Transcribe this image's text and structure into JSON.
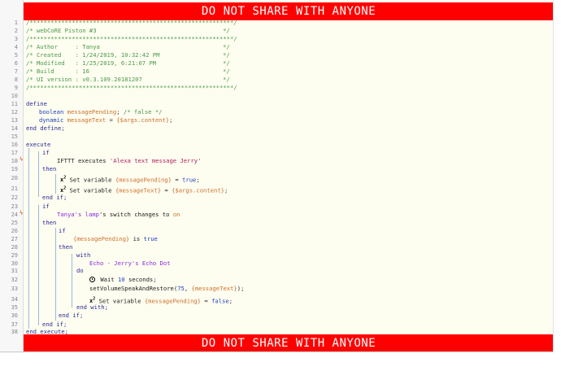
{
  "banner": {
    "top": "DO NOT SHARE WITH ANYONE",
    "bottom": "DO NOT SHARE WITH ANYONE"
  },
  "markers": {
    "trigger": "ϟ"
  },
  "line_numbers": [
    "1",
    "2",
    "3",
    "4",
    "5",
    "6",
    "7",
    "8",
    "9",
    "10",
    "11",
    "12",
    "13",
    "14",
    "15",
    "16",
    "17",
    "18",
    "19",
    "20",
    "21",
    "22",
    "23",
    "24",
    "25",
    "26",
    "27",
    "28",
    "29",
    "30",
    "31",
    "32",
    "33",
    "34",
    "35",
    "36",
    "37",
    "38"
  ],
  "code": {
    "l1": "/**********************************************************/",
    "l2a": "/* webCoRE Piston #3",
    "l2b": "*/",
    "l3": "/**********************************************************/",
    "l4a": "/* Author     : Tanya",
    "l4b": "*/",
    "l5a": "/* Created    : 1/24/2019, 10:32:42 PM",
    "l5b": "*/",
    "l6a": "/* Modified   : 1/25/2019, 6:21:07 PM",
    "l6b": "*/",
    "l7a": "/* Build      : 16",
    "l7b": "*/",
    "l8a": "/* UI version : v0.3.109.20181207",
    "l8b": "*/",
    "l9": "/**********************************************************/",
    "l11": "define",
    "l12_type": "boolean",
    "l12_var": "messagePending",
    "l12_rest": "; ",
    "l12_cmt": "/* false */",
    "l13_type": "dynamic",
    "l13_var": "messageText",
    "l13_eq": " = ",
    "l13_expr": "{$args.content}",
    "l13_end": ";",
    "l14": "end define;",
    "l16": "execute",
    "l17": "if",
    "l18_a": "IFTTT executes ",
    "l18_str": "'Alexa text message Jerry'",
    "l19": "then",
    "l20_icon": "x",
    "l20_sup": "2",
    "l20_a": " Set variable ",
    "l20_var": "{messagePending}",
    "l20_eq": " = ",
    "l20_val": "true",
    "l20_end": ";",
    "l21_icon": "x",
    "l21_sup": "2",
    "l21_a": " Set variable ",
    "l21_var": "{messageText}",
    "l21_eq": " = ",
    "l21_val": "{$args.content}",
    "l21_end": ";",
    "l22": "end if;",
    "l23": "if",
    "l24_dev": "Tanya's lamp",
    "l24_a": "'s switch changes to ",
    "l24_val": "on",
    "l25": "then",
    "l26": "if",
    "l27_var": "{messagePending}",
    "l27_a": " is ",
    "l27_val": "true",
    "l28": "then",
    "l29": "with",
    "l30_dev": "Echo - Jerry's Echo Dot",
    "l31": "do",
    "l32_a": " Wait ",
    "l32_num": "10",
    "l32_b": " seconds;",
    "l33_a": "setVolumeSpeakAndRestore(",
    "l33_num": "75",
    "l33_b": ", ",
    "l33_var": "{messageText}",
    "l33_c": ");",
    "l34_icon": "x",
    "l34_sup": "2",
    "l34_a": " Set variable ",
    "l34_var": "{messagePending}",
    "l34_eq": " = ",
    "l34_val": "false",
    "l34_end": ";",
    "l35": "end with;",
    "l36": "end if;",
    "l37": "end if;",
    "l38": "end execute;"
  },
  "colors": {
    "banner": "#ff0000",
    "comment": "#4a9a4a",
    "keyword": "#2040c0",
    "variable": "#d0702a",
    "string": "#b02060",
    "device": "#8a2be2"
  }
}
